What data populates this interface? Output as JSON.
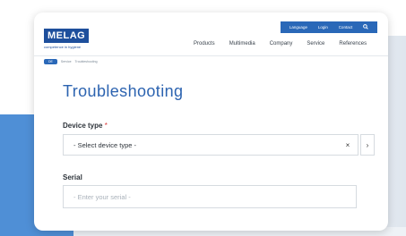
{
  "header": {
    "utility_links": [
      "Language",
      "Login",
      "Contact"
    ],
    "logo_text": "MELAG",
    "logo_tagline": "competence in hygiene",
    "nav": [
      "Products",
      "Multimedia",
      "Company",
      "Service",
      "References"
    ]
  },
  "breadcrumb": [
    "DE",
    "Service",
    "Troubleshooting"
  ],
  "page": {
    "title": "Troubleshooting",
    "device_type_label": "Device type",
    "required_marker": "*",
    "device_type_value": "- Select device type -",
    "clear_symbol": "×",
    "arrow_symbol": "›",
    "serial_label": "Serial",
    "serial_placeholder": "- Enter your serial -"
  },
  "colors": {
    "accent": "#2c63b0",
    "logo": "#1e4f9c",
    "required": "#d93636"
  }
}
